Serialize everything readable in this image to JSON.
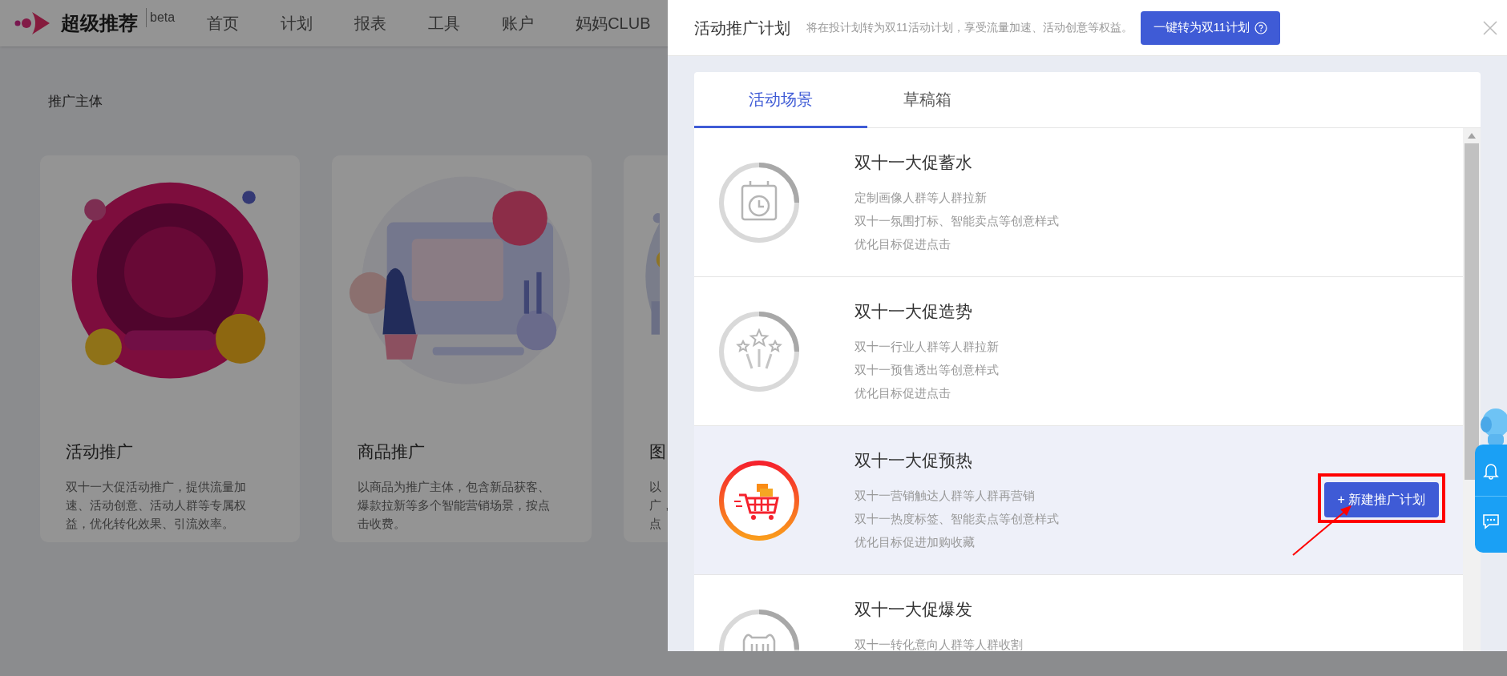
{
  "nav": {
    "brand": "超级推荐",
    "badge": "beta",
    "items": [
      {
        "label": "首页"
      },
      {
        "label": "计划"
      },
      {
        "label": "报表"
      },
      {
        "label": "工具"
      },
      {
        "label": "账户"
      },
      {
        "label": "妈妈CLUB"
      }
    ]
  },
  "section_title": "推广主体",
  "cards": [
    {
      "title": "活动推广",
      "lines": [
        "双十一大促活动推广，提供流量加",
        "速、活动创意、活动人群等专属权",
        "益，优化转化效果、引流效率。"
      ]
    },
    {
      "title": "商品推广",
      "lines": [
        "以商品为推广主体，包含新品获客、",
        "爆款拉新等多个智能营销场景，按点",
        "击收费。"
      ]
    },
    {
      "title": "图",
      "lines": [
        "以",
        "广，",
        "点"
      ]
    }
  ],
  "drawer": {
    "title": "活动推广计划",
    "description": "将在投计划转为双11活动计划，享受流量加速、活动创意等权益。",
    "convert_button": "一键转为双11计划",
    "tabs": [
      {
        "label": "活动场景",
        "selected": true
      },
      {
        "label": "草稿箱",
        "selected": false
      }
    ],
    "scenes": [
      {
        "title": "双十一大促蓄水",
        "selected": false,
        "lines": [
          "定制画像人群等人群拉新",
          "双十一氛围打标、智能卖点等创意样式",
          "优化目标促进点击"
        ]
      },
      {
        "title": "双十一大促造势",
        "selected": false,
        "lines": [
          "双十一行业人群等人群拉新",
          "双十一预售透出等创意样式",
          "优化目标促进点击"
        ]
      },
      {
        "title": "双十一大促预热",
        "selected": true,
        "lines": [
          "双十一营销触达人群等人群再营销",
          "双十一热度标签、智能卖点等创意样式",
          "优化目标促进加购收藏"
        ],
        "action": "+ 新建推广计划"
      },
      {
        "title": "双十一大促爆发",
        "selected": false,
        "lines": [
          "双十一转化意向人群等人群收割"
        ]
      }
    ]
  }
}
